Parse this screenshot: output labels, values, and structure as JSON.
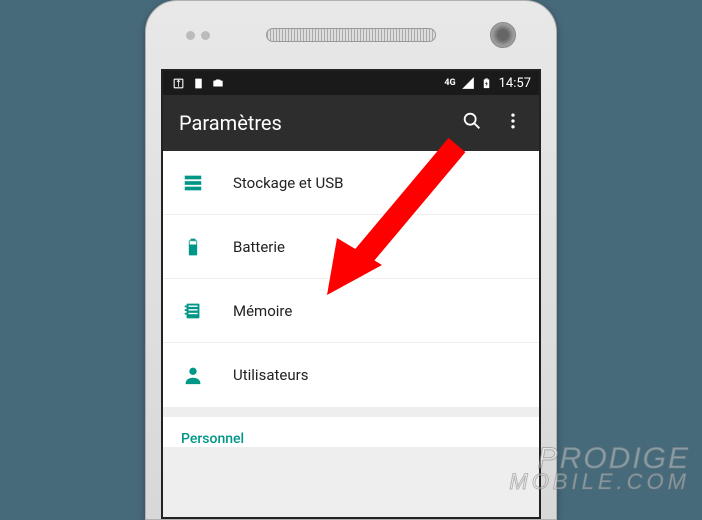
{
  "statusbar": {
    "network": "4G",
    "time": "14:57"
  },
  "appbar": {
    "title": "Paramètres"
  },
  "settings": {
    "items": [
      {
        "label": "Stockage et USB"
      },
      {
        "label": "Batterie"
      },
      {
        "label": "Mémoire"
      },
      {
        "label": "Utilisateurs"
      }
    ]
  },
  "section": {
    "header": "Personnel"
  },
  "watermark": {
    "line1": "PRODIGE",
    "line2": "MOBILE.COM"
  },
  "colors": {
    "accent": "#009688",
    "appbar": "#2d2d2d",
    "background": "#476a7a",
    "arrow": "#ff0000"
  }
}
